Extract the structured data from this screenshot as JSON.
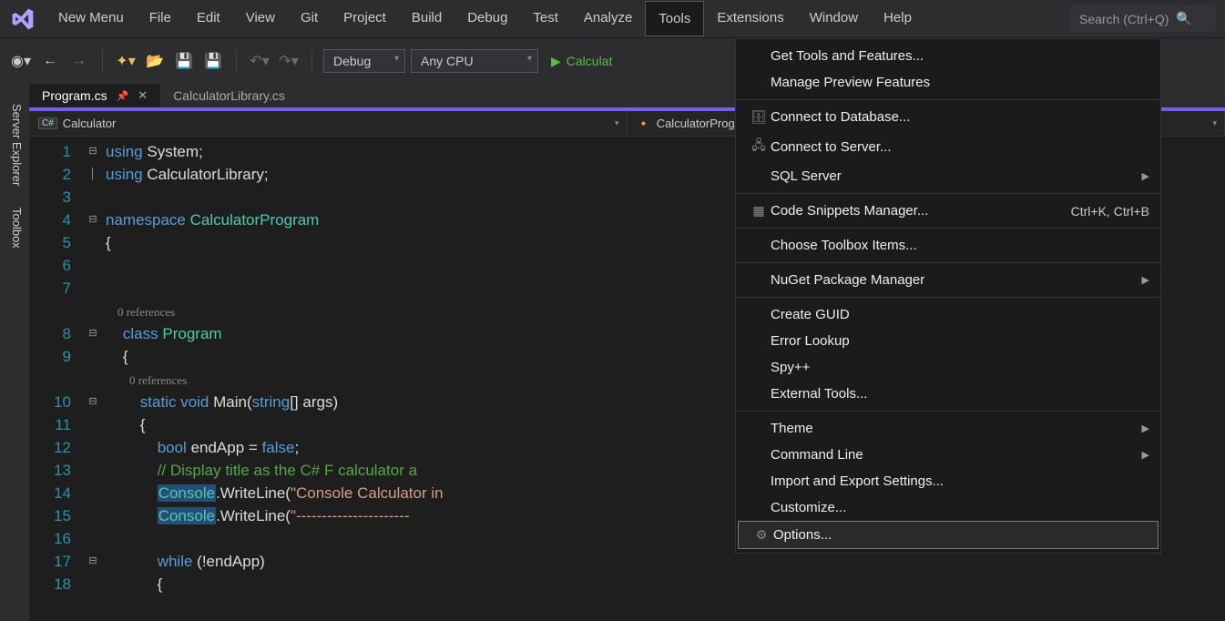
{
  "menubar": {
    "items": [
      "New Menu",
      "File",
      "Edit",
      "View",
      "Git",
      "Project",
      "Build",
      "Debug",
      "Test",
      "Analyze",
      "Tools",
      "Extensions",
      "Window",
      "Help"
    ],
    "active": "Tools",
    "search_placeholder": "Search (Ctrl+Q)"
  },
  "toolbar": {
    "config": "Debug",
    "platform": "Any CPU",
    "start_label": "Calculat"
  },
  "side_tabs": [
    "Server Explorer",
    "Toolbox"
  ],
  "tabs": {
    "active": "Program.cs",
    "inactive": "CalculatorLibrary.cs"
  },
  "nav": {
    "left": "Calculator",
    "right": "CalculatorProgram.Program"
  },
  "code": {
    "lines": [
      {
        "n": 1,
        "fold": "⊟",
        "seg": [
          {
            "t": "using ",
            "c": "kw"
          },
          {
            "t": "System;",
            "c": ""
          }
        ]
      },
      {
        "n": 2,
        "fold": "│",
        "seg": [
          {
            "t": "using ",
            "c": "kw"
          },
          {
            "t": "CalculatorLibrary;",
            "c": ""
          }
        ]
      },
      {
        "n": 3,
        "fold": "",
        "seg": [
          {
            "t": "",
            "c": ""
          }
        ]
      },
      {
        "n": 4,
        "fold": "⊟",
        "seg": [
          {
            "t": "namespace ",
            "c": "kw"
          },
          {
            "t": "CalculatorProgram",
            "c": "cls"
          }
        ]
      },
      {
        "n": 5,
        "fold": "",
        "seg": [
          {
            "t": "{",
            "c": ""
          }
        ]
      },
      {
        "n": 6,
        "fold": "",
        "seg": [
          {
            "t": "",
            "c": ""
          }
        ]
      },
      {
        "n": 7,
        "fold": "",
        "seg": [
          {
            "t": "",
            "c": ""
          }
        ]
      },
      {
        "n": 0,
        "fold": "",
        "seg": [
          {
            "t": "    0 references",
            "c": "ref"
          }
        ]
      },
      {
        "n": 8,
        "fold": "⊟",
        "seg": [
          {
            "t": "    ",
            "c": ""
          },
          {
            "t": "class ",
            "c": "kw"
          },
          {
            "t": "Program",
            "c": "cls"
          }
        ]
      },
      {
        "n": 9,
        "fold": "",
        "seg": [
          {
            "t": "    {",
            "c": ""
          }
        ]
      },
      {
        "n": 0,
        "fold": "",
        "seg": [
          {
            "t": "        0 references",
            "c": "ref"
          }
        ]
      },
      {
        "n": 10,
        "fold": "⊟",
        "seg": [
          {
            "t": "        ",
            "c": ""
          },
          {
            "t": "static void ",
            "c": "kw"
          },
          {
            "t": "Main(",
            "c": ""
          },
          {
            "t": "string",
            "c": "kw"
          },
          {
            "t": "[] args)",
            "c": ""
          }
        ]
      },
      {
        "n": 11,
        "fold": "",
        "seg": [
          {
            "t": "        {",
            "c": ""
          }
        ]
      },
      {
        "n": 12,
        "fold": "",
        "seg": [
          {
            "t": "            ",
            "c": ""
          },
          {
            "t": "bool ",
            "c": "kw"
          },
          {
            "t": "endApp = ",
            "c": ""
          },
          {
            "t": "false",
            "c": "kw"
          },
          {
            "t": ";",
            "c": ""
          }
        ]
      },
      {
        "n": 13,
        "fold": "",
        "seg": [
          {
            "t": "            ",
            "c": ""
          },
          {
            "t": "// Display title as the C# F calculator a",
            "c": "com"
          }
        ]
      },
      {
        "n": 14,
        "fold": "",
        "seg": [
          {
            "t": "            ",
            "c": ""
          },
          {
            "t": "Console",
            "c": "cls hl"
          },
          {
            "t": ".WriteLine(",
            "c": ""
          },
          {
            "t": "\"Console Calculator in ",
            "c": "str"
          }
        ]
      },
      {
        "n": 15,
        "fold": "",
        "seg": [
          {
            "t": "            ",
            "c": ""
          },
          {
            "t": "Console",
            "c": "cls hl"
          },
          {
            "t": ".WriteLine(",
            "c": ""
          },
          {
            "t": "\"----------------------",
            "c": "str"
          }
        ]
      },
      {
        "n": 16,
        "fold": "",
        "seg": [
          {
            "t": "",
            "c": ""
          }
        ]
      },
      {
        "n": 17,
        "fold": "⊟",
        "seg": [
          {
            "t": "            ",
            "c": ""
          },
          {
            "t": "while ",
            "c": "kw"
          },
          {
            "t": "(!endApp)",
            "c": ""
          }
        ]
      },
      {
        "n": 18,
        "fold": "",
        "seg": [
          {
            "t": "            {",
            "c": ""
          }
        ]
      }
    ]
  },
  "tools_menu": [
    {
      "type": "item",
      "label": "Get Tools and Features..."
    },
    {
      "type": "item",
      "label": "Manage Preview Features"
    },
    {
      "type": "sep"
    },
    {
      "type": "item",
      "label": "Connect to Database...",
      "icon": "db"
    },
    {
      "type": "item",
      "label": "Connect to Server...",
      "icon": "srv"
    },
    {
      "type": "item",
      "label": "SQL Server",
      "sub": true
    },
    {
      "type": "sep"
    },
    {
      "type": "item",
      "label": "Code Snippets Manager...",
      "icon": "snip",
      "shortcut": "Ctrl+K, Ctrl+B"
    },
    {
      "type": "sep"
    },
    {
      "type": "item",
      "label": "Choose Toolbox Items..."
    },
    {
      "type": "sep"
    },
    {
      "type": "item",
      "label": "NuGet Package Manager",
      "sub": true
    },
    {
      "type": "sep"
    },
    {
      "type": "item",
      "label": "Create GUID"
    },
    {
      "type": "item",
      "label": "Error Lookup"
    },
    {
      "type": "item",
      "label": "Spy++"
    },
    {
      "type": "item",
      "label": "External Tools..."
    },
    {
      "type": "sep"
    },
    {
      "type": "item",
      "label": "Theme",
      "sub": true
    },
    {
      "type": "item",
      "label": "Command Line",
      "sub": true
    },
    {
      "type": "item",
      "label": "Import and Export Settings..."
    },
    {
      "type": "item",
      "label": "Customize..."
    },
    {
      "type": "item",
      "label": "Options...",
      "icon": "gear",
      "hl": true
    }
  ]
}
